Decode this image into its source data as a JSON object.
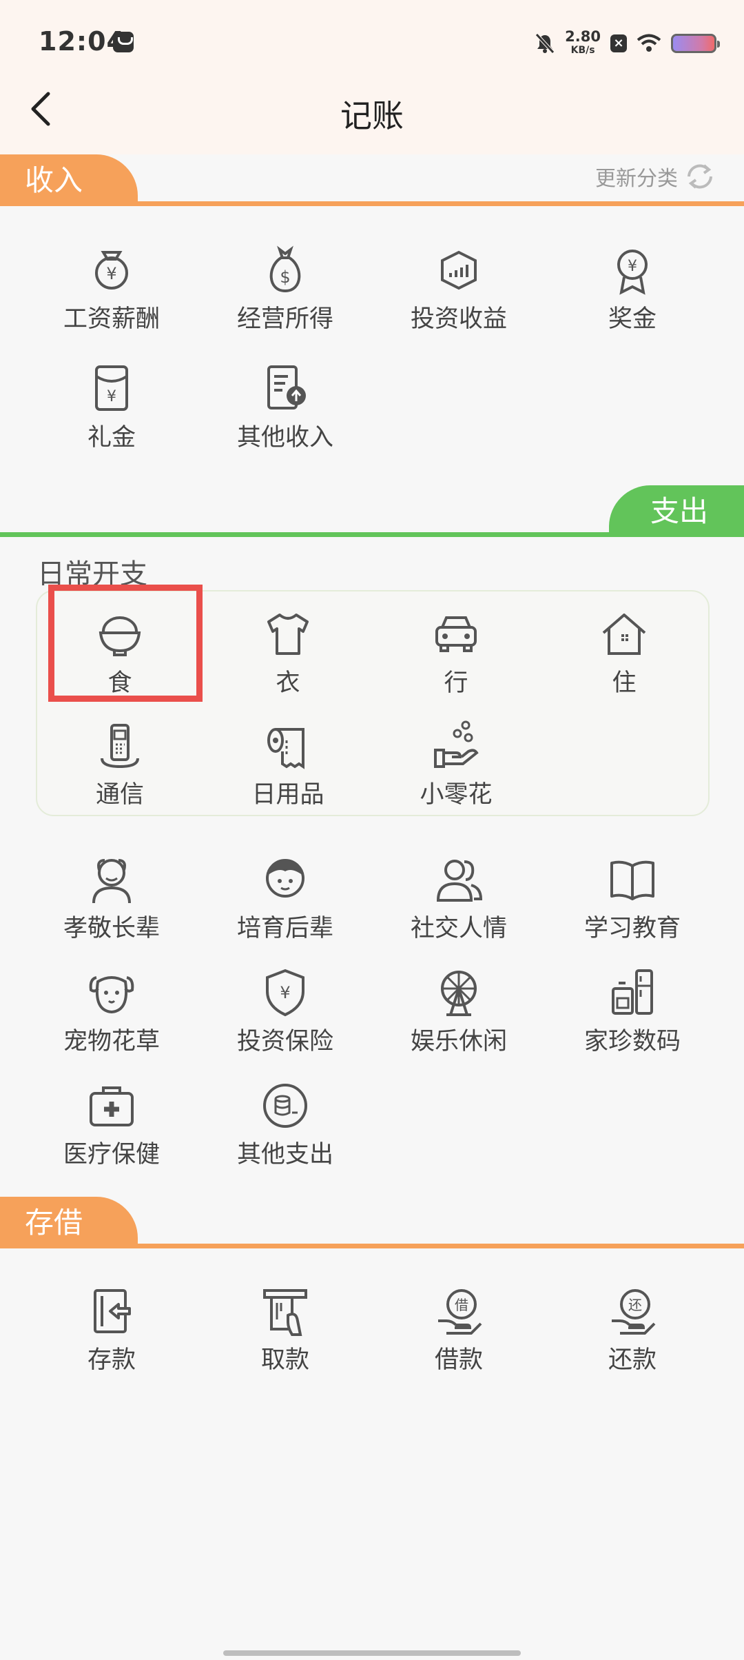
{
  "status_bar": {
    "time": "12:04",
    "net_speed_value": "2.80",
    "net_speed_unit": "KB/s"
  },
  "header": {
    "title": "记账"
  },
  "income": {
    "tab_label": "收入",
    "refresh_label": "更新分类",
    "items": [
      {
        "label": "工资薪酬",
        "icon": "salary-money-bag-icon"
      },
      {
        "label": "经营所得",
        "icon": "dollar-bag-icon"
      },
      {
        "label": "投资收益",
        "icon": "investment-chart-icon"
      },
      {
        "label": "奖金",
        "icon": "medal-yuan-icon"
      },
      {
        "label": "礼金",
        "icon": "red-envelope-icon"
      },
      {
        "label": "其他收入",
        "icon": "document-upload-icon"
      }
    ]
  },
  "expense": {
    "tab_label": "支出",
    "daily_heading": "日常开支",
    "daily_items": [
      {
        "label": "食",
        "icon": "rice-bowl-icon"
      },
      {
        "label": "衣",
        "icon": "tshirt-icon"
      },
      {
        "label": "行",
        "icon": "car-icon"
      },
      {
        "label": "住",
        "icon": "house-icon"
      },
      {
        "label": "通信",
        "icon": "phone-icon"
      },
      {
        "label": "日用品",
        "icon": "toilet-paper-icon"
      },
      {
        "label": "小零花",
        "icon": "hand-coins-icon"
      }
    ],
    "other_items": [
      {
        "label": "孝敬长辈",
        "icon": "elder-person-icon"
      },
      {
        "label": "培育后辈",
        "icon": "child-icon"
      },
      {
        "label": "社交人情",
        "icon": "people-icon"
      },
      {
        "label": "学习教育",
        "icon": "open-book-icon"
      },
      {
        "label": "宠物花草",
        "icon": "pet-dog-icon"
      },
      {
        "label": "投资保险",
        "icon": "shield-yuan-icon"
      },
      {
        "label": "娱乐休闲",
        "icon": "ferris-wheel-icon"
      },
      {
        "label": "家珍数码",
        "icon": "appliance-icon"
      },
      {
        "label": "医疗保健",
        "icon": "medical-kit-icon"
      },
      {
        "label": "其他支出",
        "icon": "coin-stack-icon"
      }
    ]
  },
  "savings": {
    "tab_label": "存借",
    "items": [
      {
        "label": "存款",
        "icon": "deposit-icon"
      },
      {
        "label": "取款",
        "icon": "withdraw-atm-icon"
      },
      {
        "label": "借款",
        "icon": "borrow-icon"
      },
      {
        "label": "还款",
        "icon": "repay-icon"
      }
    ]
  },
  "colors": {
    "income_accent": "#f6a15a",
    "expense_accent": "#62c45a",
    "highlight": "#ea4f4b"
  }
}
